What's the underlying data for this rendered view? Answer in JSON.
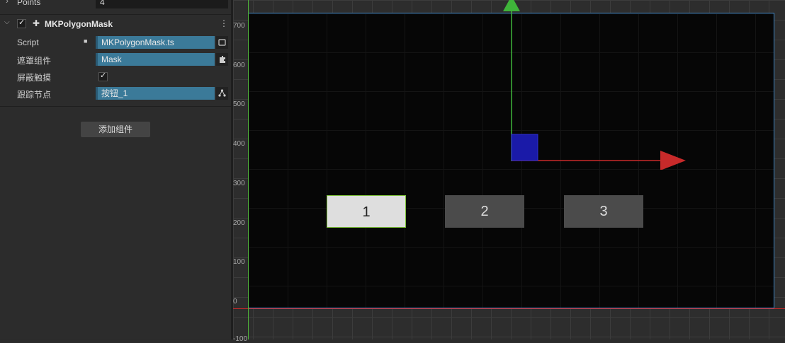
{
  "inspector": {
    "points_label": "Points",
    "points_value": "4",
    "component_title": "MKPolygonMask",
    "rows": {
      "script_label": "Script",
      "script_value": "MKPolygonMask.ts",
      "mask_label": "遮罩组件",
      "mask_value": "Mask",
      "block_label": "屏蔽触摸",
      "track_label": "跟踪节点",
      "track_value": "按钮_1"
    },
    "add_component": "添加组件"
  },
  "scene": {
    "y_ticks": [
      "700",
      "600",
      "500",
      "400",
      "300",
      "200",
      "100",
      "0",
      "-100"
    ],
    "buttons": [
      "1",
      "2",
      "3"
    ]
  }
}
